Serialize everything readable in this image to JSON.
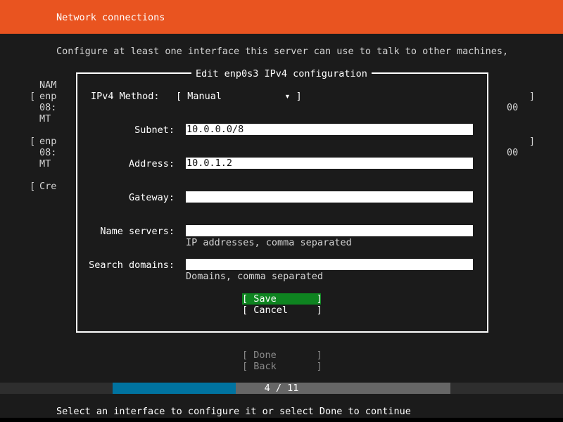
{
  "header": {
    "title": "Network connections",
    "color": "#e95420"
  },
  "subtitle": "Configure at least one interface this server can use to talk to other machines,",
  "background_table": {
    "rows": [
      {
        "text": "NAM",
        "left": ""
      },
      {
        "text": "enp",
        "left": "[",
        "right": "]"
      },
      {
        "text": "08:",
        "right_extra": "00"
      },
      {
        "text": "MT"
      },
      {
        "text": "enp",
        "left": "[",
        "right": "]"
      },
      {
        "text": "08:",
        "right_extra": "00"
      },
      {
        "text": "MT"
      },
      {
        "text": "Cre",
        "left": "["
      }
    ]
  },
  "dialog": {
    "title": "Edit enp0s3 IPv4 configuration",
    "method": {
      "label": "IPv4 Method:",
      "value": "[ Manual           ▾ ]"
    },
    "fields": [
      {
        "label": "Subnet:",
        "value": "10.0.0.0/8",
        "hint": ""
      },
      {
        "label": "Address:",
        "value": "10.0.1.2",
        "hint": ""
      },
      {
        "label": "Gateway:",
        "value": "",
        "hint": ""
      },
      {
        "label": "Name servers:",
        "value": "",
        "hint": "IP addresses, comma separated"
      },
      {
        "label": "Search domains:",
        "value": "",
        "hint": "Domains, comma separated"
      }
    ],
    "save_label": "[ Save       ]",
    "cancel_label": "[ Cancel     ]"
  },
  "bottom_buttons": {
    "done": "[ Done       ]",
    "back": "[ Back       ]"
  },
  "progress": {
    "text": "4 / 11",
    "fraction": 0.3636
  },
  "footer": "Select an interface to configure it or select Done to continue"
}
